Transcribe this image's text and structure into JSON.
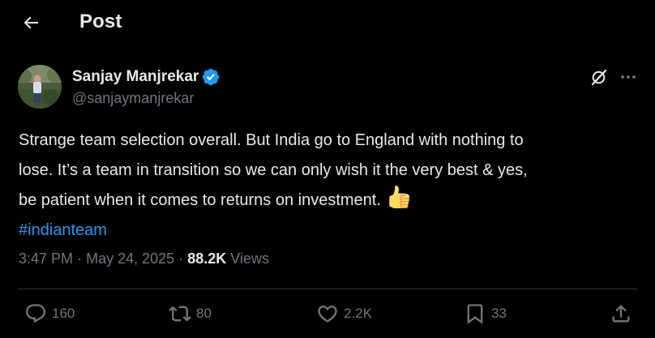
{
  "header": {
    "back_icon": "arrow-left-icon",
    "title": "Post"
  },
  "author": {
    "name": "Sanjay Manjrekar",
    "handle": "@sanjaymanjrekar",
    "verified": true,
    "verified_color": "#1d9bf0"
  },
  "tweet": {
    "lines": [
      "Strange team selection overall. But India go to England with nothing to",
      "lose. It’s a team in transition so we can only wish it the very best & yes,",
      "be patient when it comes to returns on investment."
    ],
    "emoji": "thumbs-up-icon",
    "hashtag": "#indianteam"
  },
  "meta": {
    "time": "3:47 PM",
    "separator": "·",
    "date": "May 24, 2025",
    "views_count": "88.2K",
    "views_label": "Views"
  },
  "actions": {
    "replies": "160",
    "reposts": "80",
    "likes": "2.2K",
    "bookmarks": "33"
  },
  "colors": {
    "background": "#000000",
    "text": "#e7e9ea",
    "secondary": "#71767b",
    "accent": "#1d9bf0",
    "divider": "#2f3336"
  }
}
